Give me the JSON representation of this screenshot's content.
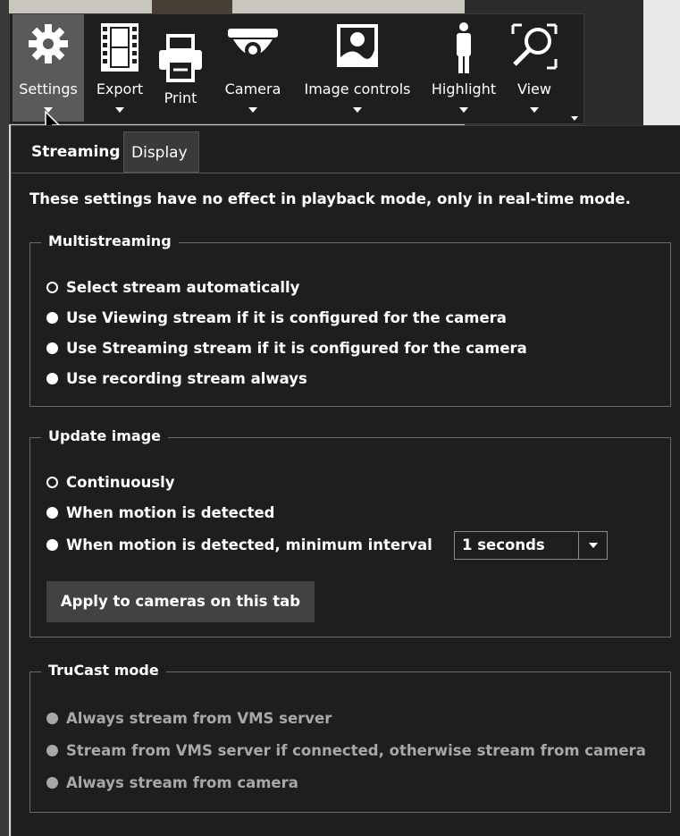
{
  "toolbar": {
    "buttons": [
      {
        "label": "Settings",
        "icon": "gear-icon",
        "active": true
      },
      {
        "label": "Export",
        "icon": "film-icon"
      },
      {
        "label": "Print",
        "icon": "printer-icon"
      },
      {
        "label": "Camera",
        "icon": "dome-camera-icon"
      },
      {
        "label": "Image controls",
        "icon": "image-icon"
      },
      {
        "label": "Highlight",
        "icon": "person-icon"
      },
      {
        "label": "View",
        "icon": "zoom-icon"
      }
    ]
  },
  "tabs": [
    {
      "label": "Streaming",
      "active": true
    },
    {
      "label": "Display",
      "active": false
    }
  ],
  "note": "These settings have no effect in playback mode, only in real-time mode.",
  "multistreaming": {
    "title": "Multistreaming",
    "options": [
      {
        "label": "Select stream automatically",
        "selected": true
      },
      {
        "label": "Use Viewing stream if it is configured for the camera",
        "selected": false
      },
      {
        "label": "Use Streaming stream if it is configured for the camera",
        "selected": false
      },
      {
        "label": "Use recording stream always",
        "selected": false
      }
    ]
  },
  "update_image": {
    "title": "Update image",
    "options": [
      {
        "label": "Continuously",
        "selected": true
      },
      {
        "label": "When motion is detected",
        "selected": false
      },
      {
        "label": "When motion is detected, minimum interval",
        "selected": false
      }
    ],
    "interval_value": "1 seconds",
    "apply_label": "Apply to cameras on this tab"
  },
  "trucast": {
    "title": "TruCast mode",
    "options": [
      {
        "label": "Always stream from VMS server",
        "disabled": true
      },
      {
        "label": "Stream from VMS server if connected, otherwise stream from camera",
        "disabled": true
      },
      {
        "label": "Always stream from camera",
        "disabled": true
      }
    ]
  },
  "colors": {
    "panel_bg": "#1e1e1e",
    "active_toolbar_bg": "#5a5a5a",
    "disabled_text": "#a8a8a8"
  }
}
